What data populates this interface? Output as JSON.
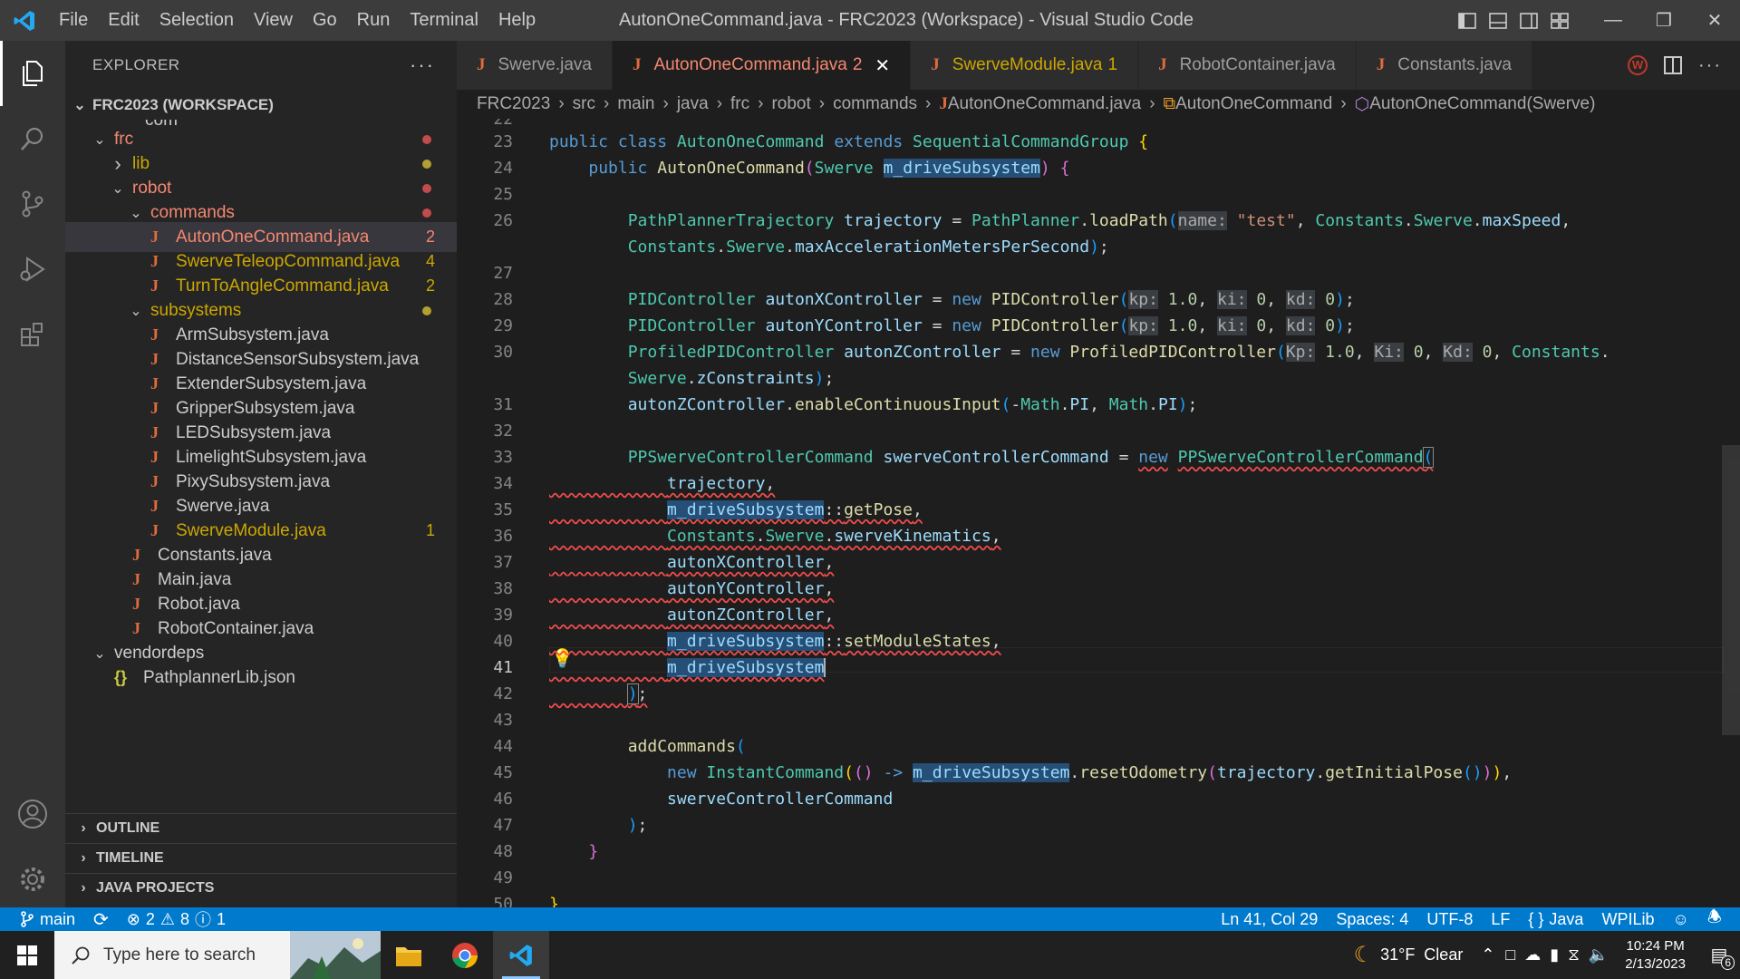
{
  "titlebar": {
    "menu": [
      "File",
      "Edit",
      "Selection",
      "View",
      "Go",
      "Run",
      "Terminal",
      "Help"
    ],
    "title": "AutonOneCommand.java - FRC2023 (Workspace) - Visual Studio Code"
  },
  "sidebar": {
    "header": "EXPLORER",
    "workspace": "FRC2023 (WORKSPACE)",
    "partial_top": "com",
    "tree": [
      {
        "label": "frc",
        "type": "folder",
        "depth": 1,
        "open": true,
        "status": "dot-error"
      },
      {
        "label": "lib",
        "type": "folder",
        "depth": 2,
        "open": false,
        "status": "dot-warn"
      },
      {
        "label": "robot",
        "type": "folder",
        "depth": 2,
        "open": true,
        "status": "dot-error"
      },
      {
        "label": "commands",
        "type": "folder",
        "depth": 3,
        "open": true,
        "status": "dot-error"
      },
      {
        "label": "AutonOneCommand.java",
        "type": "java",
        "depth": 4,
        "badge": "2",
        "status": "error",
        "selected": true
      },
      {
        "label": "SwerveTeleopCommand.java",
        "type": "java",
        "depth": 4,
        "badge": "4",
        "status": "warn"
      },
      {
        "label": "TurnToAngleCommand.java",
        "type": "java",
        "depth": 4,
        "badge": "2",
        "status": "warn"
      },
      {
        "label": "subsystems",
        "type": "folder",
        "depth": 3,
        "open": true,
        "status": "dot-warn"
      },
      {
        "label": "ArmSubsystem.java",
        "type": "java",
        "depth": 4
      },
      {
        "label": "DistanceSensorSubsystem.java",
        "type": "java",
        "depth": 4
      },
      {
        "label": "ExtenderSubsystem.java",
        "type": "java",
        "depth": 4
      },
      {
        "label": "GripperSubsystem.java",
        "type": "java",
        "depth": 4
      },
      {
        "label": "LEDSubsystem.java",
        "type": "java",
        "depth": 4
      },
      {
        "label": "LimelightSubsystem.java",
        "type": "java",
        "depth": 4
      },
      {
        "label": "PixySubsystem.java",
        "type": "java",
        "depth": 4
      },
      {
        "label": "Swerve.java",
        "type": "java",
        "depth": 4
      },
      {
        "label": "SwerveModule.java",
        "type": "java",
        "depth": 4,
        "badge": "1",
        "status": "warn"
      },
      {
        "label": "Constants.java",
        "type": "java",
        "depth": 3
      },
      {
        "label": "Main.java",
        "type": "java",
        "depth": 3
      },
      {
        "label": "Robot.java",
        "type": "java",
        "depth": 3
      },
      {
        "label": "RobotContainer.java",
        "type": "java",
        "depth": 3
      },
      {
        "label": "vendordeps",
        "type": "folder",
        "depth": 1,
        "open": true
      },
      {
        "label": "PathplannerLib.json",
        "type": "json",
        "depth": 2
      }
    ],
    "sections": [
      "OUTLINE",
      "TIMELINE",
      "JAVA PROJECTS"
    ]
  },
  "tabs": [
    {
      "label": "Swerve.java",
      "active": false
    },
    {
      "label": "AutonOneCommand.java",
      "badge": "2",
      "active": true,
      "status": "error"
    },
    {
      "label": "SwerveModule.java",
      "badge": "1",
      "active": false,
      "status": "warn"
    },
    {
      "label": "RobotContainer.java",
      "active": false
    },
    {
      "label": "Constants.java",
      "active": false
    }
  ],
  "breadcrumbs": [
    "FRC2023",
    "src",
    "main",
    "java",
    "frc",
    "robot",
    "commands",
    "AutonOneCommand.java",
    "AutonOneCommand",
    "AutonOneCommand(Swerve)"
  ],
  "editor": {
    "partial_line_number": "22",
    "line_numbers": [
      "23",
      "24",
      "25",
      "26",
      "",
      "27",
      "28",
      "29",
      "30",
      "",
      "31",
      "32",
      "33",
      "34",
      "35",
      "36",
      "37",
      "38",
      "39",
      "40",
      "41",
      "42",
      "43",
      "44",
      "45",
      "46",
      "47",
      "48",
      "49",
      "50"
    ],
    "current_line": "41"
  },
  "status": {
    "branch": "main",
    "errors": "2",
    "warnings": "8",
    "info": "1",
    "position": "Ln 41, Col 29",
    "spaces": "Spaces: 4",
    "encoding": "UTF-8",
    "eol": "LF",
    "language": "Java",
    "extension": "WPILib"
  },
  "taskbar": {
    "search_placeholder": "Type here to search",
    "weather": "31°F  Clear",
    "time": "10:24 PM",
    "date": "2/13/2023",
    "notifications": "6"
  },
  "colors": {
    "accent": "#007acc",
    "error": "#f48771",
    "warning": "#cca700",
    "java_icon": "#e06c3c"
  }
}
